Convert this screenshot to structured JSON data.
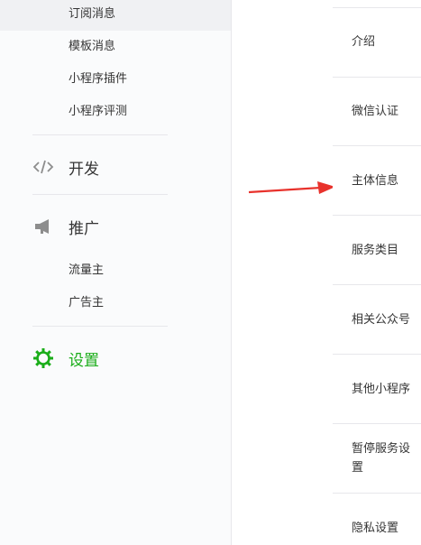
{
  "sidebar": {
    "messages": [
      {
        "label": "订阅消息"
      },
      {
        "label": "模板消息"
      },
      {
        "label": "小程序插件"
      },
      {
        "label": "小程序评测"
      }
    ],
    "develop": {
      "label": "开发",
      "icon": "code-icon"
    },
    "promote": {
      "label": "推广",
      "icon": "megaphone-icon",
      "items": [
        {
          "label": "流量主"
        },
        {
          "label": "广告主"
        }
      ]
    },
    "settings": {
      "label": "设置",
      "icon": "gear-icon",
      "color": "#1aad19"
    }
  },
  "settings_nav": {
    "items": [
      {
        "label": "介绍"
      },
      {
        "label": "微信认证"
      },
      {
        "label": "主体信息"
      },
      {
        "label": "服务类目"
      },
      {
        "label": "相关公众号"
      },
      {
        "label": "其他小程序"
      },
      {
        "label": "暂停服务设置"
      },
      {
        "label": "隐私设置"
      }
    ]
  },
  "annotation": {
    "color": "#e8322c"
  }
}
